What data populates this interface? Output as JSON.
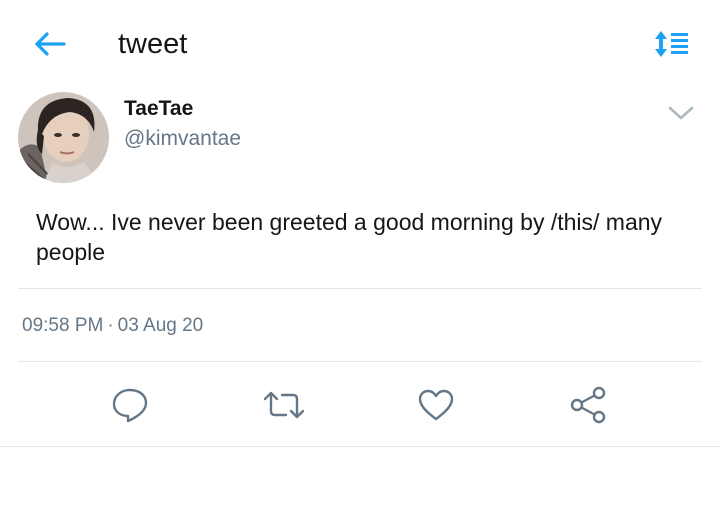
{
  "header": {
    "title": "tweet",
    "back_icon": "arrow-left-icon",
    "sort_icon": "sort-toggle-icon",
    "accent_color": "#1da1f2"
  },
  "author": {
    "display_name": "TaeTae",
    "handle": "@kimvantae",
    "avatar_icon": "user-avatar"
  },
  "tweet": {
    "text": "Wow... Ive never been greeted a good morning by /this/ many people",
    "time": "09:58 PM",
    "separator": "·",
    "date": "03 Aug 20"
  },
  "actions": [
    {
      "name": "reply",
      "icon": "reply-icon"
    },
    {
      "name": "retweet",
      "icon": "retweet-icon"
    },
    {
      "name": "like",
      "icon": "heart-icon"
    },
    {
      "name": "share",
      "icon": "share-icon"
    }
  ],
  "colors": {
    "text_primary": "#14171a",
    "text_secondary": "#657786",
    "divider": "#e1e8ed",
    "icon": "#657786"
  }
}
